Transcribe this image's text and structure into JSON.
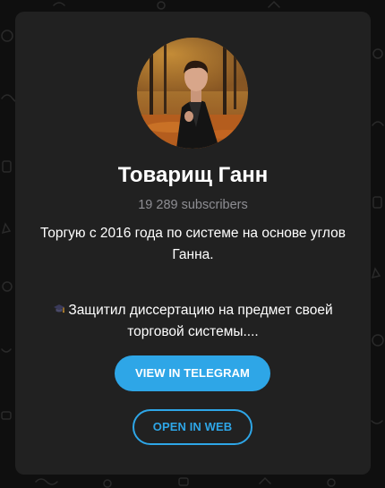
{
  "channel": {
    "title": "Товарищ Ганн",
    "subscribers": "19 289 subscribers",
    "description_line1": "Торгую с 2016 года по системе на основе углов Ганна.",
    "description_line2": "Защитил диссертацию на предмет своей торговой системы...."
  },
  "actions": {
    "view_in_telegram": "VIEW IN TELEGRAM",
    "open_in_web": "OPEN IN WEB"
  },
  "colors": {
    "page_background": "#0f0f0f",
    "card_background": "#212121",
    "accent": "#2ea6e7",
    "muted_text": "#8e8e93"
  },
  "icons": {
    "description_emoji": "graduation-cap-icon"
  }
}
